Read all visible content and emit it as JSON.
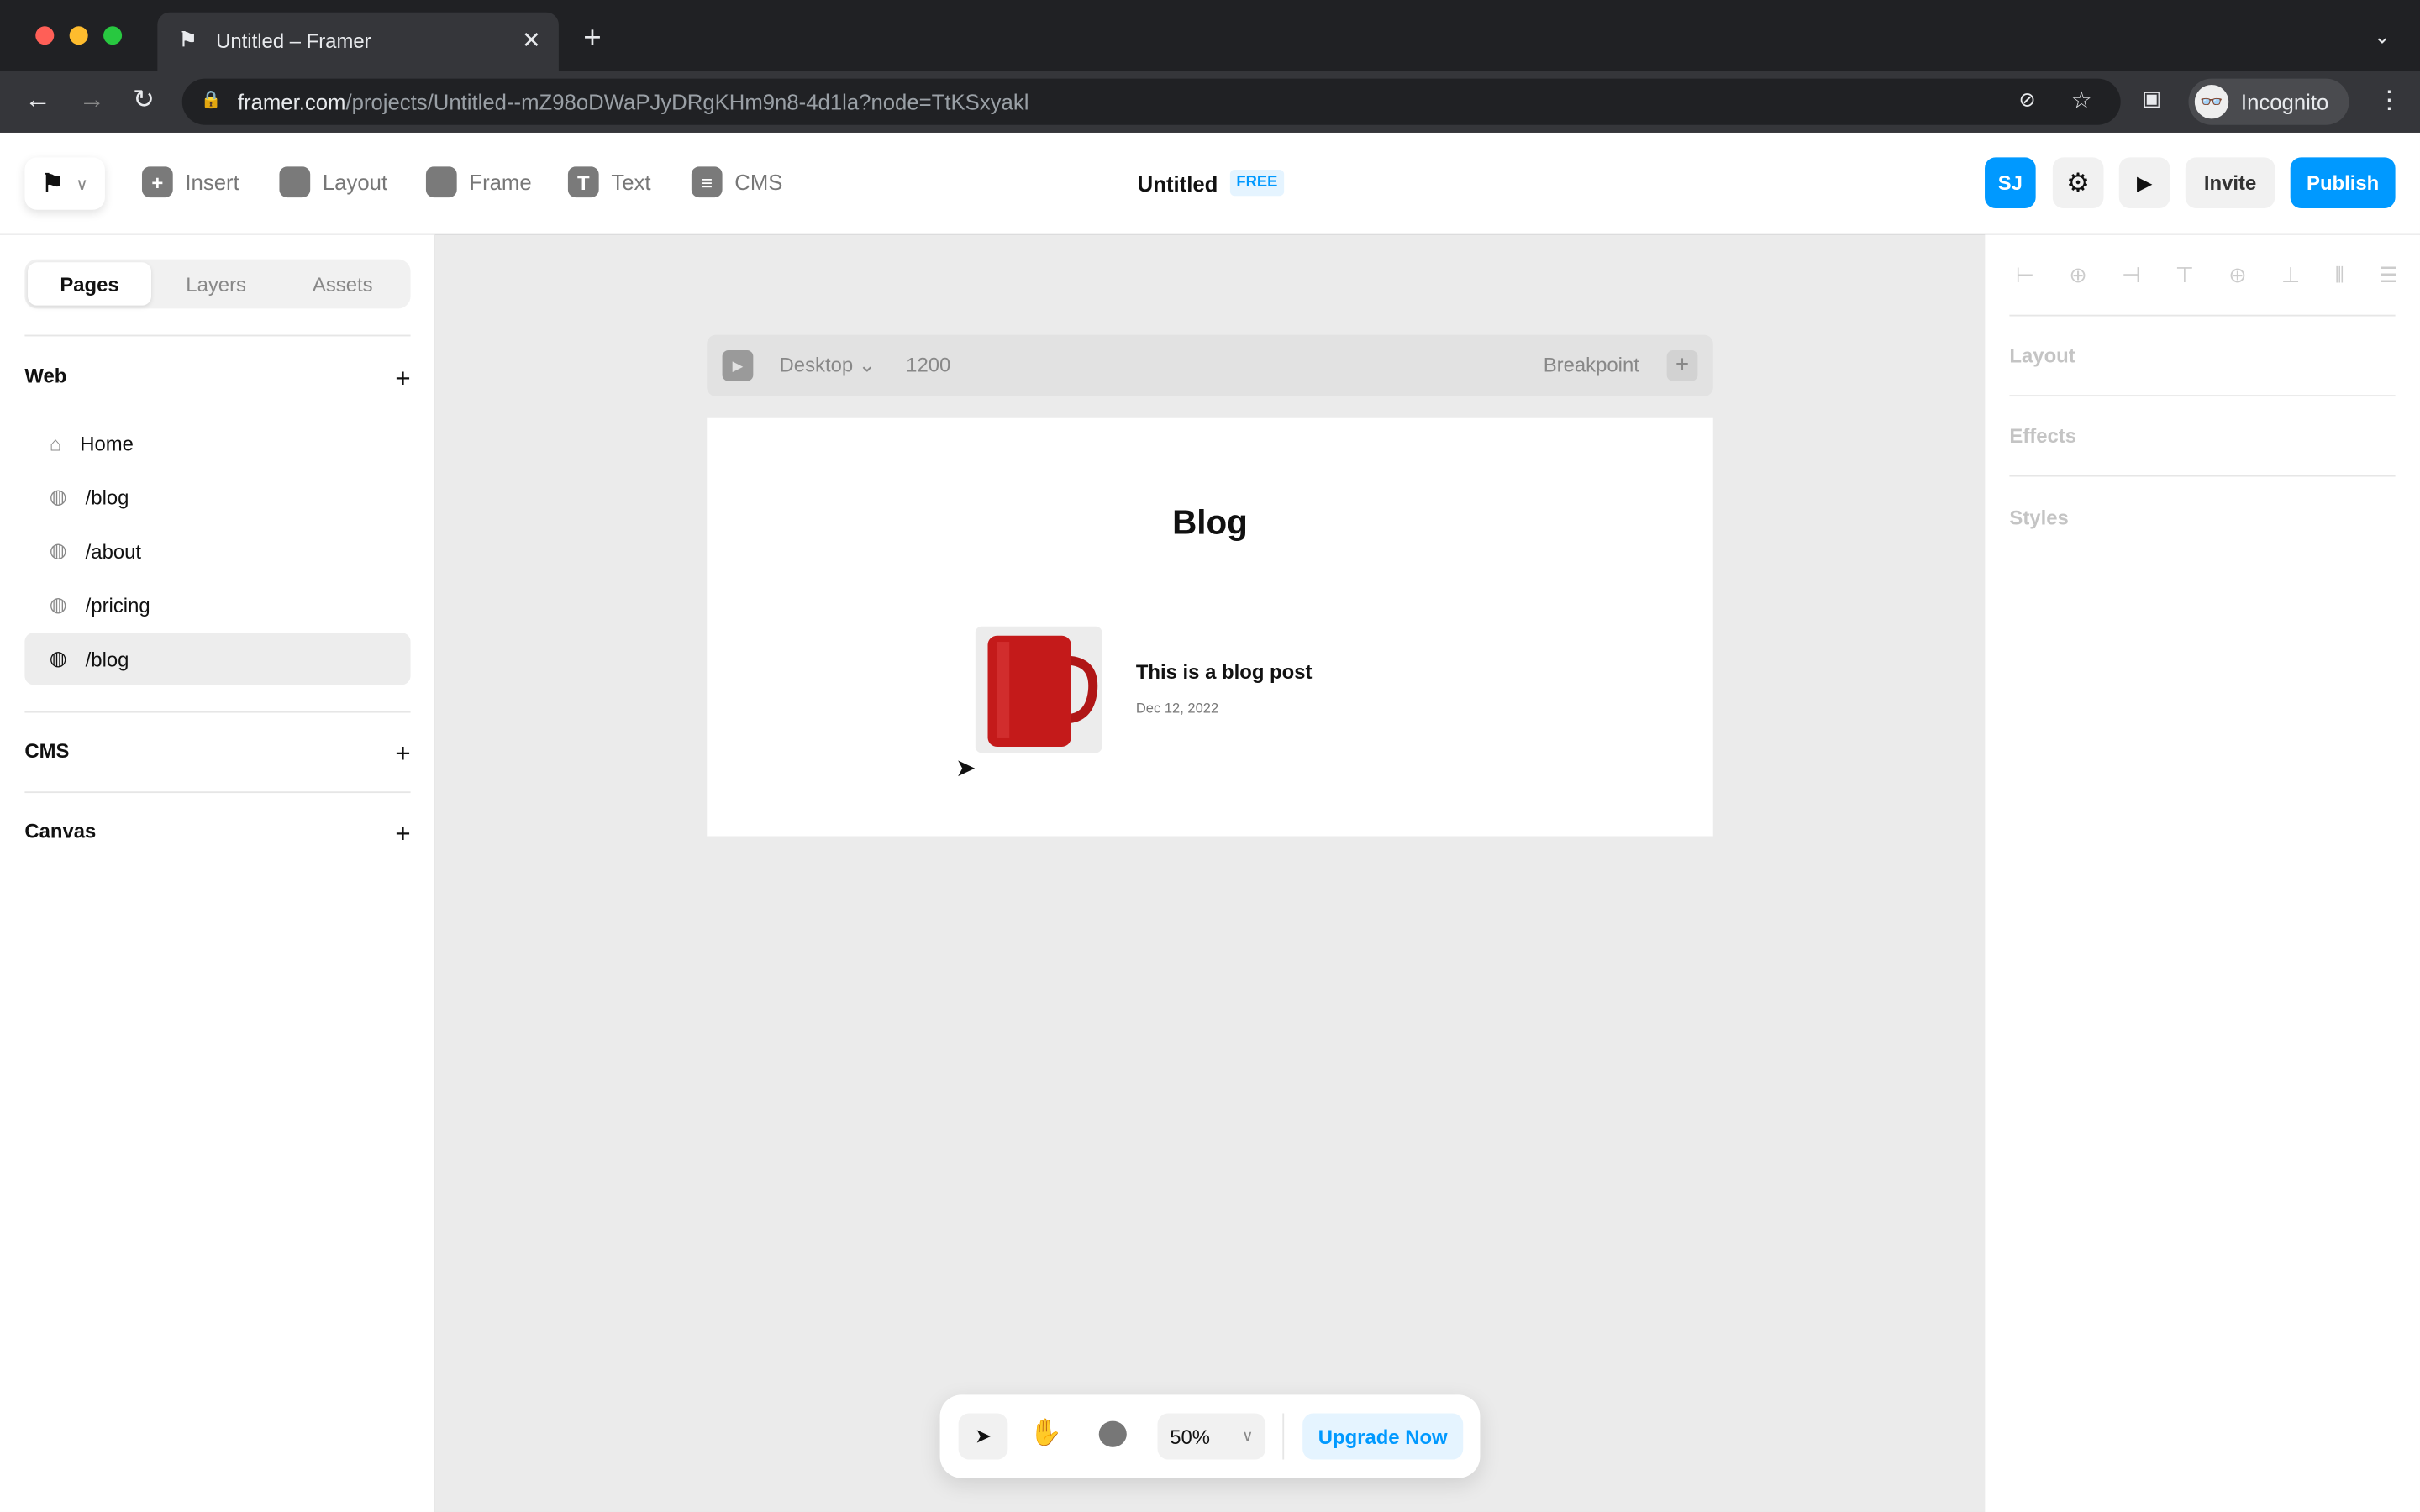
{
  "browser": {
    "tab_title": "Untitled – Framer",
    "url_domain": "framer.com",
    "url_path": "/projects/Untitled--mZ98oDWaPJyDRgKHm9n8-4d1la?node=TtKSxyakl",
    "profile": "Incognito"
  },
  "toolbar": {
    "items": [
      {
        "label": "Insert",
        "icon": "plus-icon"
      },
      {
        "label": "Layout",
        "icon": "layout-icon"
      },
      {
        "label": "Frame",
        "icon": "frame-icon"
      },
      {
        "label": "Text",
        "icon": "text-icon"
      },
      {
        "label": "CMS",
        "icon": "database-icon"
      }
    ],
    "project_title": "Untitled",
    "plan_badge": "FREE",
    "avatar": "SJ",
    "invite": "Invite",
    "publish": "Publish"
  },
  "left_panel": {
    "tabs": [
      "Pages",
      "Layers",
      "Assets"
    ],
    "active_tab": "Pages",
    "web_section": "Web",
    "pages": [
      {
        "label": "Home",
        "icon": "home-icon"
      },
      {
        "label": "/blog",
        "icon": "globe-icon"
      },
      {
        "label": "/about",
        "icon": "globe-icon"
      },
      {
        "label": "/pricing",
        "icon": "globe-icon"
      },
      {
        "label": "/blog",
        "icon": "globe-icon",
        "selected": true
      }
    ],
    "cms_section": "CMS",
    "canvas_section": "Canvas"
  },
  "canvas": {
    "breakpoint_name": "Desktop",
    "width_value": "1200",
    "breakpoint_label": "Breakpoint",
    "frame": {
      "heading": "Blog",
      "post_title": "This is a blog post",
      "post_date": "Dec 12, 2022"
    }
  },
  "bottom_bar": {
    "zoom": "50%",
    "upgrade": "Upgrade Now"
  },
  "right_panel": {
    "sections": [
      "Layout",
      "Effects",
      "Styles"
    ]
  },
  "colors": {
    "accent": "#0099ff",
    "mug": "#c41a1a"
  }
}
